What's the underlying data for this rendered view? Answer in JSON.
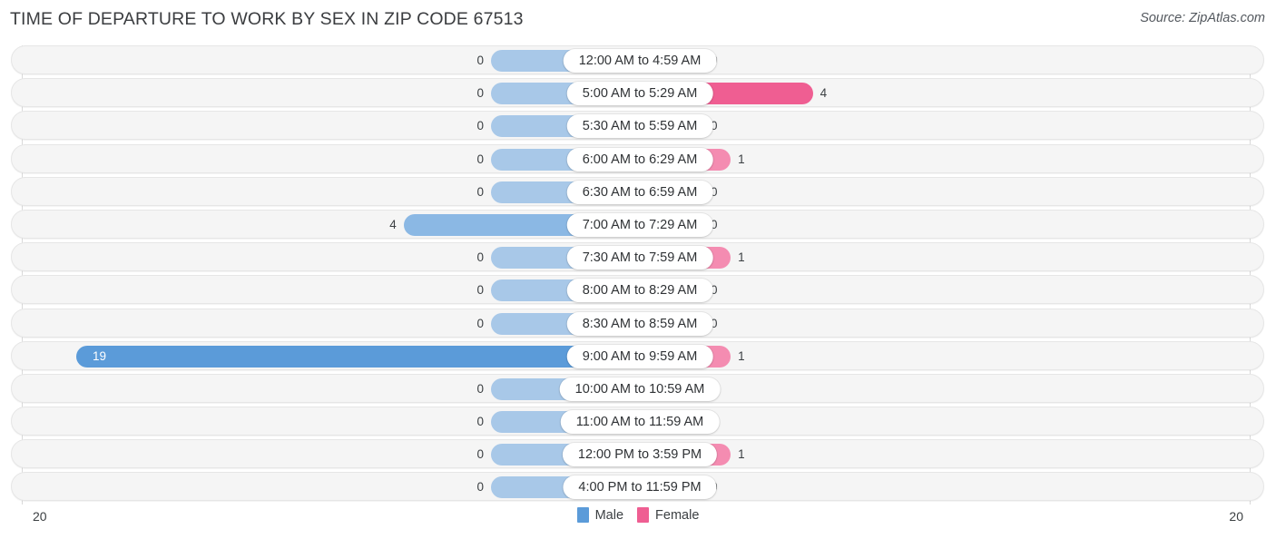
{
  "header": {
    "title": "TIME OF DEPARTURE TO WORK BY SEX IN ZIP CODE 67513",
    "source": "Source: ZipAtlas.com"
  },
  "legend": {
    "male": {
      "label": "Male",
      "color": "#5b9bd9"
    },
    "female": {
      "label": "Female",
      "color": "#ef5e92"
    }
  },
  "axis": {
    "left_max": "20",
    "right_max": "20"
  },
  "chart_data": {
    "type": "bar",
    "title": "TIME OF DEPARTURE TO WORK BY SEX IN ZIP CODE 67513",
    "subtitle": "Source: ZipAtlas.com",
    "orientation": "horizontal-diverging",
    "xlabel": "",
    "ylabel": "",
    "xlim": [
      20,
      20
    ],
    "grid": false,
    "legend_position": "bottom-center",
    "categories": [
      "12:00 AM to 4:59 AM",
      "5:00 AM to 5:29 AM",
      "5:30 AM to 5:59 AM",
      "6:00 AM to 6:29 AM",
      "6:30 AM to 6:59 AM",
      "7:00 AM to 7:29 AM",
      "7:30 AM to 7:59 AM",
      "8:00 AM to 8:29 AM",
      "8:30 AM to 8:59 AM",
      "9:00 AM to 9:59 AM",
      "10:00 AM to 10:59 AM",
      "11:00 AM to 11:59 AM",
      "12:00 PM to 3:59 PM",
      "4:00 PM to 11:59 PM"
    ],
    "series": [
      {
        "name": "Male",
        "values": [
          0,
          0,
          0,
          0,
          0,
          4,
          0,
          0,
          0,
          19,
          0,
          0,
          0,
          0
        ]
      },
      {
        "name": "Female",
        "values": [
          0,
          4,
          0,
          1,
          0,
          0,
          1,
          0,
          0,
          1,
          0,
          0,
          1,
          0
        ]
      }
    ]
  },
  "rows": [
    {
      "category": "12:00 AM to 4:59 AM",
      "male": "0",
      "female": "0"
    },
    {
      "category": "5:00 AM to 5:29 AM",
      "male": "0",
      "female": "4"
    },
    {
      "category": "5:30 AM to 5:59 AM",
      "male": "0",
      "female": "0"
    },
    {
      "category": "6:00 AM to 6:29 AM",
      "male": "0",
      "female": "1"
    },
    {
      "category": "6:30 AM to 6:59 AM",
      "male": "0",
      "female": "0"
    },
    {
      "category": "7:00 AM to 7:29 AM",
      "male": "4",
      "female": "0"
    },
    {
      "category": "7:30 AM to 7:59 AM",
      "male": "0",
      "female": "1"
    },
    {
      "category": "8:00 AM to 8:29 AM",
      "male": "0",
      "female": "0"
    },
    {
      "category": "8:30 AM to 8:59 AM",
      "male": "0",
      "female": "0"
    },
    {
      "category": "9:00 AM to 9:59 AM",
      "male": "19",
      "female": "1"
    },
    {
      "category": "10:00 AM to 10:59 AM",
      "male": "0",
      "female": "0"
    },
    {
      "category": "11:00 AM to 11:59 AM",
      "male": "0",
      "female": "0"
    },
    {
      "category": "12:00 PM to 3:59 PM",
      "male": "0",
      "female": "1"
    },
    {
      "category": "4:00 PM to 11:59 PM",
      "male": "0",
      "female": "0"
    }
  ]
}
